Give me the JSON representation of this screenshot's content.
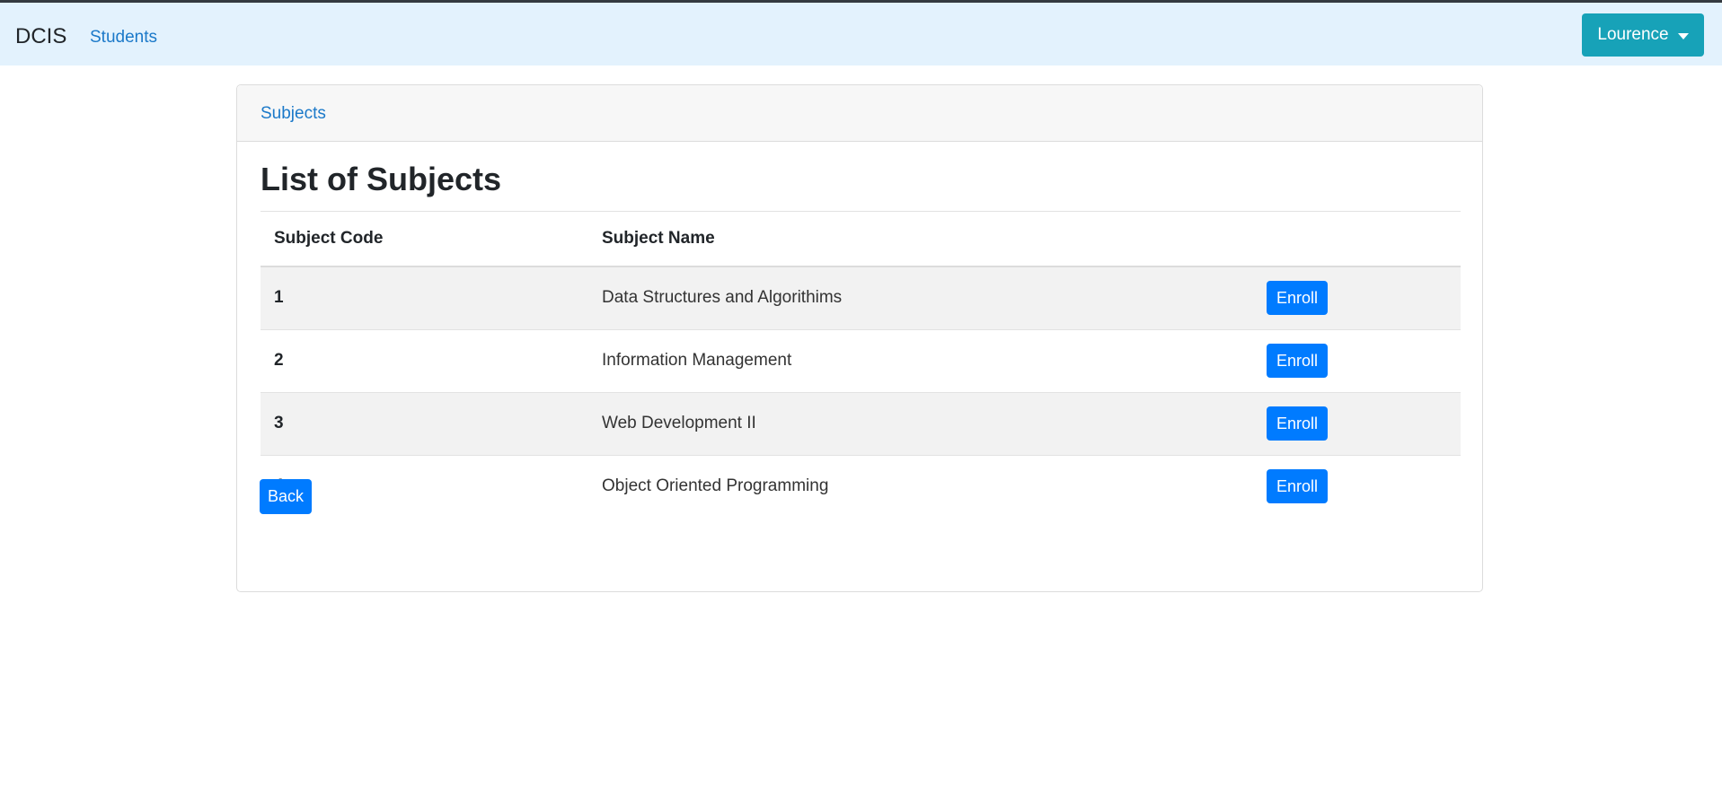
{
  "navbar": {
    "brand": "DCIS",
    "links": [
      {
        "label": "Students"
      }
    ],
    "user": {
      "label": "Lourence"
    }
  },
  "breadcrumb": {
    "label": "Subjects"
  },
  "page": {
    "title": "List of Subjects"
  },
  "table": {
    "headers": [
      "Subject Code",
      "Subject Name",
      ""
    ],
    "rows": [
      {
        "code": "1",
        "name": "Data Structures and Algorithims",
        "action": "Enroll"
      },
      {
        "code": "2",
        "name": "Information Management",
        "action": "Enroll"
      },
      {
        "code": "3",
        "name": "Web Development II",
        "action": "Enroll"
      },
      {
        "code": "4",
        "name": "Object Oriented Programming",
        "action": "Enroll"
      }
    ]
  },
  "actions": {
    "back_label": "Back"
  },
  "colors": {
    "navbar_bg": "#e3f2fd",
    "link": "#1b79c9",
    "primary": "#007bff",
    "user_button": "#17a2b8"
  }
}
